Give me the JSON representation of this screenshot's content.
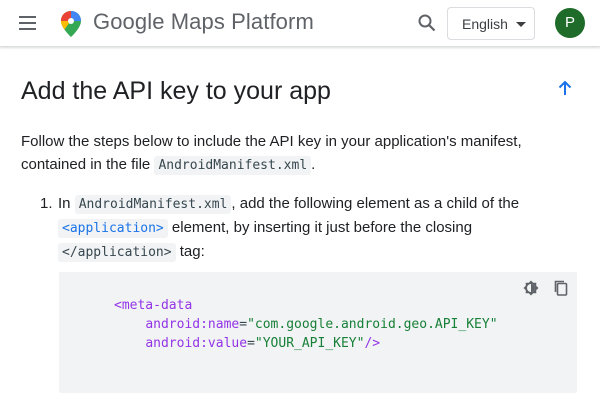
{
  "header": {
    "brand": "Google Maps Platform",
    "language": "English",
    "avatar_letter": "P"
  },
  "main": {
    "title": "Add the API key to your app",
    "intro_part1": "Follow the steps below to include the API key in your application's manifest, contained in the file ",
    "intro_code": "AndroidManifest.xml",
    "intro_part2": ".",
    "step": {
      "number": "1.",
      "part1": "In ",
      "code1": "AndroidManifest.xml",
      "part2": ", add the following element as a child of the ",
      "code2": "<application>",
      "part3": " element, by inserting it just before the closing ",
      "code3": "</application>",
      "part4": " tag:"
    },
    "code": {
      "line1_tag": "<meta-data",
      "line2_attr": "android:name",
      "line2_eq": "=",
      "line2_val": "\"com.google.android.geo.API_KEY\"",
      "line3_attr": "android:value",
      "line3_eq": "=",
      "line3_val": "\"YOUR_API_KEY\"",
      "line3_end": "/>"
    }
  },
  "icons": {
    "menu": "menu-icon",
    "logo": "maps-pin-logo",
    "search": "search-icon",
    "caret": "caret-down-icon",
    "up": "arrow-up-icon",
    "theme": "theme-toggle-icon",
    "copy": "copy-icon"
  },
  "colors": {
    "accent": "#1a73e8",
    "avatar_bg": "#1e6b2a",
    "code_bg": "#f1f3f4",
    "code_tag": "#9334e6",
    "code_value": "#188038"
  }
}
